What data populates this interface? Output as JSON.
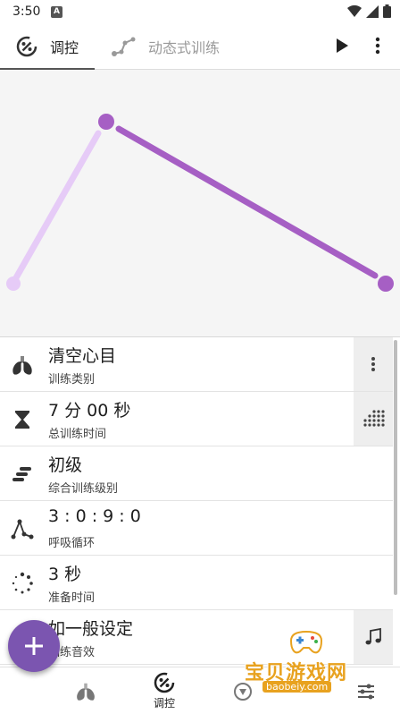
{
  "status_bar": {
    "time": "3:50",
    "notification_icon": "a-icon",
    "system_icons": [
      "wifi-icon",
      "signal-icon",
      "battery-icon"
    ]
  },
  "tabs": [
    {
      "label": "调控",
      "icon": "dial-percent-icon",
      "active": true
    },
    {
      "label": "动态式训练",
      "icon": "graph-nodes-icon",
      "active": false
    }
  ],
  "toolbar": {
    "play_icon": "play-icon",
    "more_icon": "more-vert-icon"
  },
  "colors": {
    "accent": "#7b55b0",
    "graph_line": "#a65fc4",
    "graph_line_light": "#e6cbf7",
    "graph_bg": "#f5f5f5",
    "watermark": "#e8a21f"
  },
  "settings": [
    {
      "title": "清空心目",
      "subtitle": "训练类别",
      "icon": "lungs-icon",
      "action_icon": "more-vert-icon"
    },
    {
      "title": "7 分 00 秒",
      "subtitle": "总训练时间",
      "icon": "hourglass-icon",
      "action_icon": "dot-grid-icon"
    },
    {
      "title": "初级",
      "subtitle": "综合训练级别",
      "icon": "level-bars-icon",
      "action_icon": ""
    },
    {
      "title": "3 : 0 : 9 : 0",
      "subtitle": "呼吸循环",
      "icon": "breath-cycle-icon",
      "action_icon": ""
    },
    {
      "title": "3 秒",
      "subtitle": "准备时间",
      "icon": "loading-dots-icon",
      "action_icon": ""
    },
    {
      "title": "如一般设定",
      "subtitle": "训练音效",
      "icon": "music-note-icon",
      "action_icon": "music-notes-icon"
    }
  ],
  "fab": {
    "icon": "plus-icon"
  },
  "bottom_nav": [
    {
      "label": "",
      "icon": "lungs-icon"
    },
    {
      "label": "调控",
      "icon": "dial-percent-icon"
    },
    {
      "label": "",
      "icon": "compass-icon"
    },
    {
      "label": "",
      "icon": "sliders-icon"
    }
  ],
  "watermark": {
    "title": "宝贝游戏网",
    "url": "baobeiy.com"
  }
}
